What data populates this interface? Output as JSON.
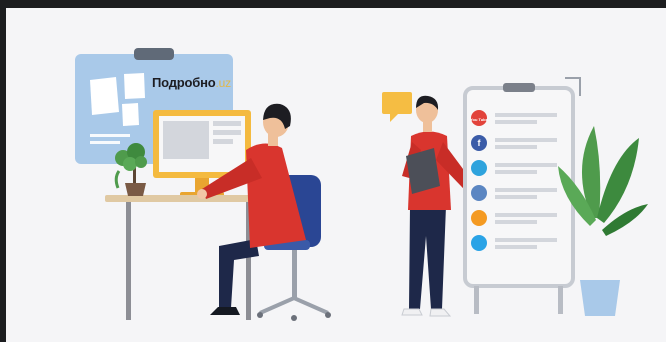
{
  "brand": {
    "name": "Подробно",
    "suffix": ".uz"
  },
  "board_icons": [
    {
      "icon": "youtube-icon",
      "color": "#e2433b",
      "label": "You Tube"
    },
    {
      "icon": "facebook-icon",
      "color": "#3b5ca8",
      "label": "f"
    },
    {
      "icon": "telegram-icon",
      "color": "#2ea3dd",
      "label": ""
    },
    {
      "icon": "vk-icon",
      "color": "#5b86c2",
      "label": ""
    },
    {
      "icon": "odnoklassniki-icon",
      "color": "#f49a22",
      "label": ""
    },
    {
      "icon": "twitter-icon",
      "color": "#2aa3e6",
      "label": ""
    }
  ],
  "colors": {
    "background": "#f5f5f7",
    "screen_blue": "#a9c9e9",
    "monitor_yellow": "#f4ba3f",
    "shirt_red": "#d9352e",
    "pants_navy": "#1e2849",
    "chair_blue": "#2a4694",
    "plant_green": "#4f9b4c"
  }
}
